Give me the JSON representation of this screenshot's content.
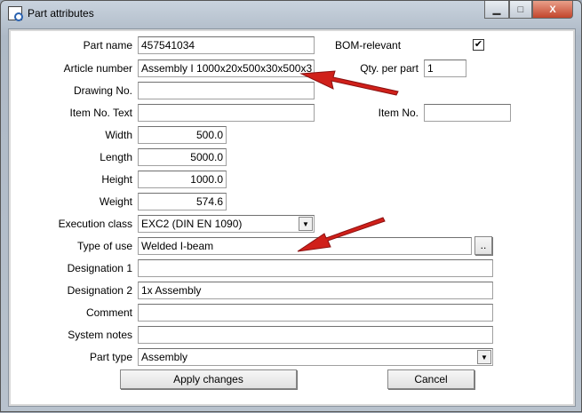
{
  "window": {
    "title": "Part attributes",
    "minimize": "▁",
    "maximize": "□",
    "close": "X"
  },
  "fields": {
    "part_name": {
      "label": "Part name",
      "value": "457541034"
    },
    "article_number": {
      "label": "Article number",
      "value": "Assembly I 1000x20x500x30x500x3"
    },
    "drawing_no": {
      "label": "Drawing No.",
      "value": ""
    },
    "item_no_text": {
      "label": "Item No. Text",
      "value": ""
    },
    "width": {
      "label": "Width",
      "value": "500.0"
    },
    "length": {
      "label": "Length",
      "value": "5000.0"
    },
    "height": {
      "label": "Height",
      "value": "1000.0"
    },
    "weight": {
      "label": "Weight",
      "value": "574.6"
    },
    "execution_class": {
      "label": "Execution class",
      "value": "EXC2 (DIN EN 1090)"
    },
    "type_of_use": {
      "label": "Type of use",
      "value": "Welded I-beam",
      "browse": ".."
    },
    "designation1": {
      "label": "Designation 1",
      "value": ""
    },
    "designation2": {
      "label": "Designation 2",
      "value": "1x Assembly"
    },
    "comment": {
      "label": "Comment",
      "value": ""
    },
    "system_notes": {
      "label": "System notes",
      "value": ""
    },
    "part_type": {
      "label": "Part type",
      "value": "Assembly"
    },
    "bom_relevant": {
      "label": "BOM-relevant",
      "checked": true,
      "mark": "✔"
    },
    "qty_per_part": {
      "label": "Qty. per part",
      "value": "1"
    },
    "item_no": {
      "label": "Item No.",
      "value": ""
    }
  },
  "buttons": {
    "apply": "Apply changes",
    "cancel": "Cancel"
  },
  "colors": {
    "arrow": "#d0201a"
  }
}
